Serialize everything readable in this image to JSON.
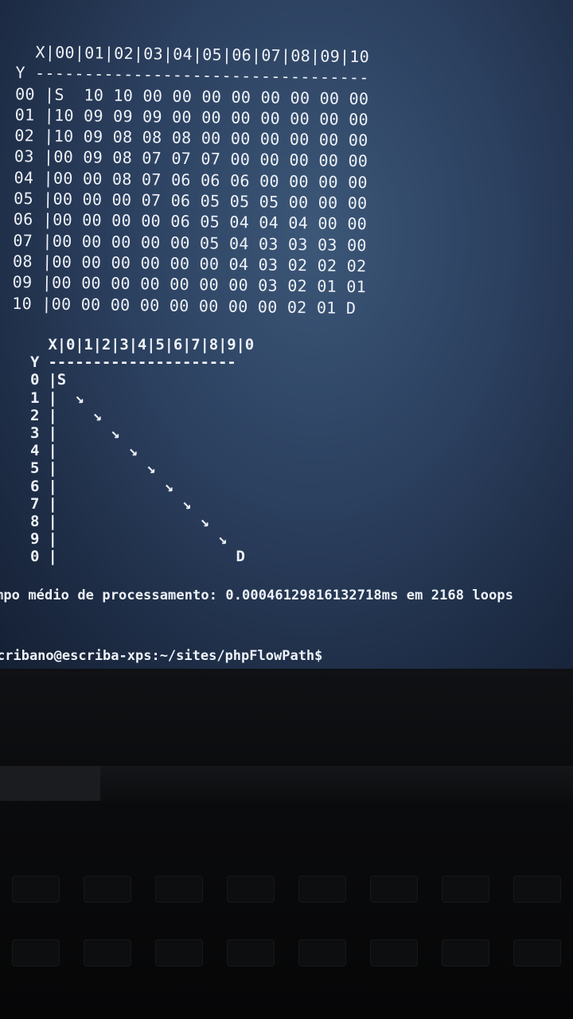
{
  "terminal": {
    "grid_weights": [
      "  X|00|01|02|03|04|05|06|07|08|09|10",
      "Y ----------------------------------",
      "00 |S  10 10 00 00 00 00 00 00 00 00",
      "01 |10 09 09 09 00 00 00 00 00 00 00",
      "02 |10 09 08 08 08 00 00 00 00 00 00",
      "03 |00 09 08 07 07 07 00 00 00 00 00",
      "04 |00 00 08 07 06 06 06 00 00 00 00",
      "05 |00 00 00 07 06 05 05 05 00 00 00",
      "06 |00 00 00 00 06 05 04 04 04 00 00",
      "07 |00 00 00 00 00 05 04 03 03 03 00",
      "08 |00 00 00 00 00 00 04 03 02 02 02",
      "09 |00 00 00 00 00 00 00 03 02 01 01",
      "10 |00 00 00 00 00 00 00 00 02 01 D"
    ],
    "grid_path": [
      "  X|0|1|2|3|4|5|6|7|8|9|0",
      "Y ---------------------",
      "0 |S",
      "1 |  ↘",
      "2 |    ↘",
      "3 |      ↘",
      "4 |        ↘",
      "5 |          ↘",
      "6 |            ↘",
      "7 |              ↘",
      "8 |                ↘",
      "9 |                  ↘",
      "0 |                    D"
    ],
    "stats_line": "mpo médio de processamento: 0.00046129816132718ms em 2168 loops",
    "prompt": "cribano@escriba-xps:~/sites/phpFlowPath$"
  }
}
